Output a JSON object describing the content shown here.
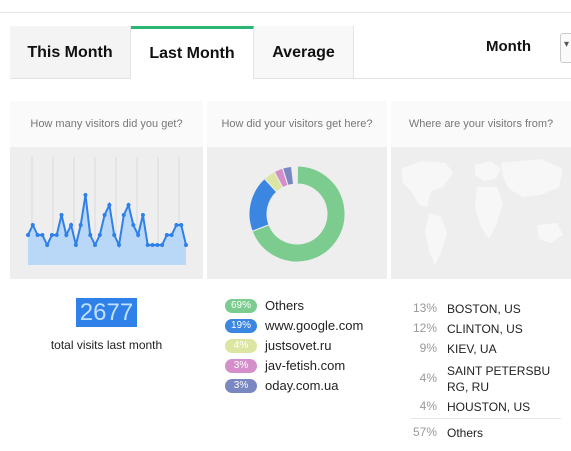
{
  "tabs": [
    {
      "label": "This Month"
    },
    {
      "label": "Last Month"
    },
    {
      "label": "Average"
    }
  ],
  "period_select": {
    "label": "Month",
    "arrow": "▾"
  },
  "columns": {
    "visitors": {
      "heading": "How many visitors did you get?",
      "total": "2677",
      "caption": "total visits last month"
    },
    "sources": {
      "heading": "How did your visitors get here?",
      "items": [
        {
          "pct": "69%",
          "name": "Others",
          "color": "#7ccc8f"
        },
        {
          "pct": "19%",
          "name": "www.google.com",
          "color": "#3a86e0"
        },
        {
          "pct": "4%",
          "name": "justsovet.ru",
          "color": "#dde5a3"
        },
        {
          "pct": "3%",
          "name": "jav-fetish.com",
          "color": "#d48fcb"
        },
        {
          "pct": "3%",
          "name": "oday.com.ua",
          "color": "#7a88c2"
        }
      ]
    },
    "locations": {
      "heading": "Where are your visitors from?",
      "items": [
        {
          "pct": "13%",
          "name": "BOSTON, US"
        },
        {
          "pct": "12%",
          "name": "CLINTON, US"
        },
        {
          "pct": "9%",
          "name": "KIEV, UA"
        },
        {
          "pct": "4%",
          "name": "SAINT PETERSBU RG, RU"
        },
        {
          "pct": "4%",
          "name": "HOUSTON, US"
        },
        {
          "pct": "57%",
          "name": "Others"
        }
      ]
    }
  },
  "colors": {
    "accent_tab": "#2bb673",
    "line_chart": "#2f80e8",
    "total_badge": "#2f80e8"
  },
  "chart_data": {
    "type": "line",
    "values": [
      3,
      4,
      3,
      3,
      2,
      3,
      3,
      5,
      3,
      4,
      2,
      4,
      7,
      3,
      2,
      3,
      5,
      6,
      3,
      2,
      5,
      6,
      4,
      3,
      5,
      2,
      2,
      2,
      2,
      3,
      3,
      4,
      4,
      2
    ],
    "ylim": [
      0,
      10
    ]
  }
}
